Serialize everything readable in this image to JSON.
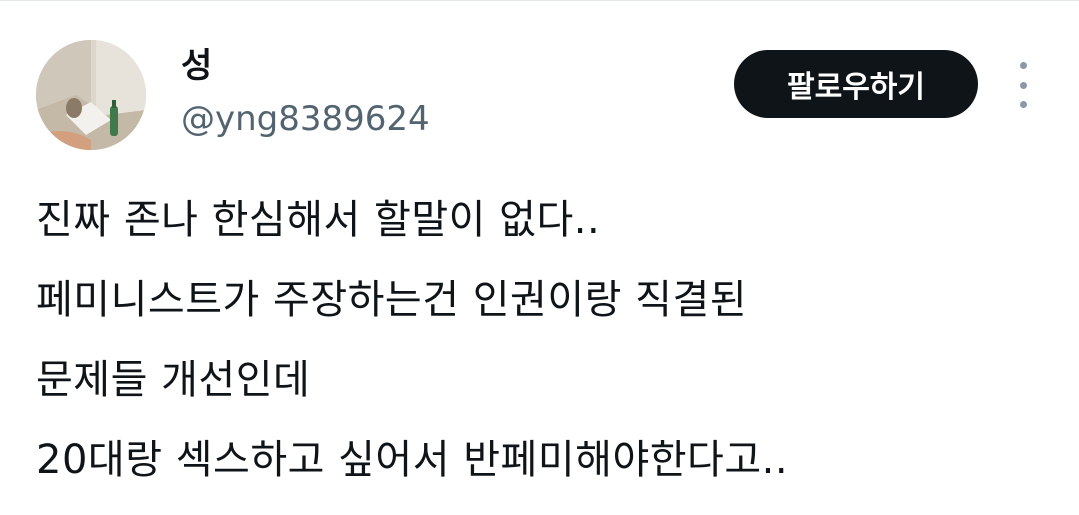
{
  "user": {
    "display_name": "성",
    "handle": "@yng8389624",
    "avatar_icon": "avatar-photo"
  },
  "actions": {
    "follow_label": "팔로우하기",
    "more_icon": "more-vertical-icon"
  },
  "tweet": {
    "lines": [
      "진짜 존나 한심해서 할말이 없다..",
      "페미니스트가 주장하는건 인권이랑 직결된",
      "문제들 개선인데",
      "20대랑 섹스하고 싶어서 반페미해야한다고.."
    ]
  },
  "colors": {
    "text_primary": "#0f1419",
    "text_secondary": "#536471",
    "button_bg": "#0f1419",
    "button_text": "#ffffff",
    "icon_muted": "#8b98a5"
  }
}
